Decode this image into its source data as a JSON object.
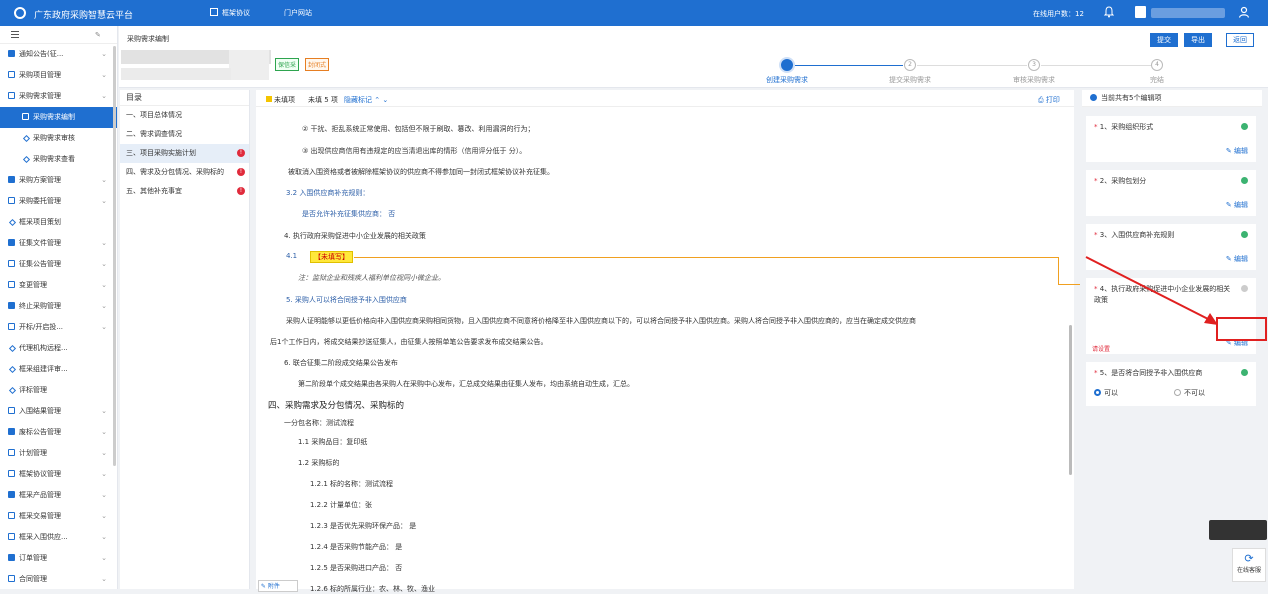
{
  "topbar": {
    "title": "广东政府采购智慧云平台",
    "nav_framework": "框架协议",
    "nav_portal": "门户网站",
    "online": "在线用户数：12"
  },
  "header": {
    "breadcrumb": "采购需求编制",
    "tag1": "保信采",
    "tag2": "封闭式",
    "btn_submit": "提交",
    "btn_export": "导出",
    "btn_back": "返回"
  },
  "steps": [
    {
      "num": "1",
      "label": "创建采购需求"
    },
    {
      "num": "2",
      "label": "提交采购需求"
    },
    {
      "num": "3",
      "label": "审核采购需求"
    },
    {
      "num": "4",
      "label": "完结"
    }
  ],
  "sidebar": {
    "items": [
      {
        "label": "通知公告(征...",
        "type": "parent"
      },
      {
        "label": "采购项目管理",
        "type": "parent"
      },
      {
        "label": "采购需求管理",
        "type": "parent"
      },
      {
        "label": "采购需求编制",
        "type": "active"
      },
      {
        "label": "采购需求审核",
        "type": "sub"
      },
      {
        "label": "采购需求查看",
        "type": "sub"
      },
      {
        "label": "采购方案管理",
        "type": "parent"
      },
      {
        "label": "采购委托管理",
        "type": "parent"
      },
      {
        "label": "框采项目策划",
        "type": "leaf"
      },
      {
        "label": "征集文件管理",
        "type": "parent"
      },
      {
        "label": "征集公告管理",
        "type": "parent"
      },
      {
        "label": "变更管理",
        "type": "parent"
      },
      {
        "label": "终止采购管理",
        "type": "parent"
      },
      {
        "label": "开标/开启投...",
        "type": "parent"
      },
      {
        "label": "代理机构远程...",
        "type": "leaf"
      },
      {
        "label": "框采组建评审...",
        "type": "leaf"
      },
      {
        "label": "评标管理",
        "type": "leaf"
      },
      {
        "label": "入围结果管理",
        "type": "parent"
      },
      {
        "label": "废标公告管理",
        "type": "parent"
      },
      {
        "label": "计划管理",
        "type": "parent"
      },
      {
        "label": "框架协议管理",
        "type": "parent"
      },
      {
        "label": "框采产品管理",
        "type": "parent"
      },
      {
        "label": "框采交易管理",
        "type": "parent"
      },
      {
        "label": "框采入围供应...",
        "type": "parent"
      },
      {
        "label": "订单管理",
        "type": "parent"
      },
      {
        "label": "合同管理",
        "type": "parent"
      }
    ]
  },
  "toc": {
    "title": "目录",
    "items": [
      {
        "label": "一、项目总体情况",
        "err": ""
      },
      {
        "label": "二、需求调查情况",
        "err": ""
      },
      {
        "label": "三、项目采购实施计划",
        "err": "!"
      },
      {
        "label": "四、需求及分包情况、采购标的",
        "err": "!"
      },
      {
        "label": "五、其他补充事宜",
        "err": "!"
      }
    ]
  },
  "doc": {
    "toolbar": {
      "unfilled": "未填项",
      "unfilled_count": "未填 5 项",
      "hide_marks": "隐藏标记",
      "print": "打印"
    },
    "lines": [
      "②  干扰、拒乱系统正常使用、包括但不限于刷取、篡改、利用漏洞的行为；",
      "③  出现供应商信用有违规定的应当清退出库的情形（信用评分低于 分）。",
      "被取消入围资格或者被解除框架协议的供应商不得参加同一封闭式框架协议补充征集。",
      "3.2   入围供应商补充规则：",
      "是否允许补充征集供应商：  否",
      "4. 执行政府采购促进中小企业发展的相关政策",
      "4.1",
      "【未填写】",
      "注：监狱企业和残疾人福利单位视同小微企业。",
      "5. 采购人可以将合同授予非入围供应商",
      "采购人证明能够以更低价格向非入围供应商采购相同货物，且入围供应商不同意将价格降至非入围供应商以下的，可以将合同授予非入围供应商。采购人将合同授予非入围供应商的，应当在确定成交供应商",
      "后1个工作日内，将成交结果抄送征集人，由征集人按照单笔公告要求发布成交结果公告。",
      "6. 联合征集二阶段成交结果公告发布",
      "第二阶段单个成交结果由各采购人在采购中心发布，汇总成交结果由征集人发布，均由系统自动生成，汇总。",
      "四、采购需求及分包情况、采购标的",
      "一分包名称：测试流程",
      "1.1 采购品目：复印纸",
      "1.2 采购标的",
      "1.2.1 标的名称：测试流程",
      "1.2.2 计量单位：张",
      "1.2.3 是否优先采购环保产品：  是",
      "1.2.4 是否采购节能产品：  是",
      "1.2.5 是否采购进口产品：  否",
      "1.2.6 标的所属行业：农、林、牧、渔业"
    ],
    "bottom_tab": "附件"
  },
  "right": {
    "header": "当前共有5个编辑项",
    "edit": "编辑",
    "warn": "请设置",
    "cards": [
      {
        "q": "1、采购组织形式"
      },
      {
        "q": "2、采购包划分"
      },
      {
        "q": "3、入围供应商补充规则"
      },
      {
        "q": "4、执行政府采购促进中小企业发展的相关政策"
      },
      {
        "q": "5、是否将合同授予非入围供应商",
        "opt1": "可以",
        "opt2": "不可以"
      }
    ]
  },
  "float": {
    "service": "在线客服"
  }
}
